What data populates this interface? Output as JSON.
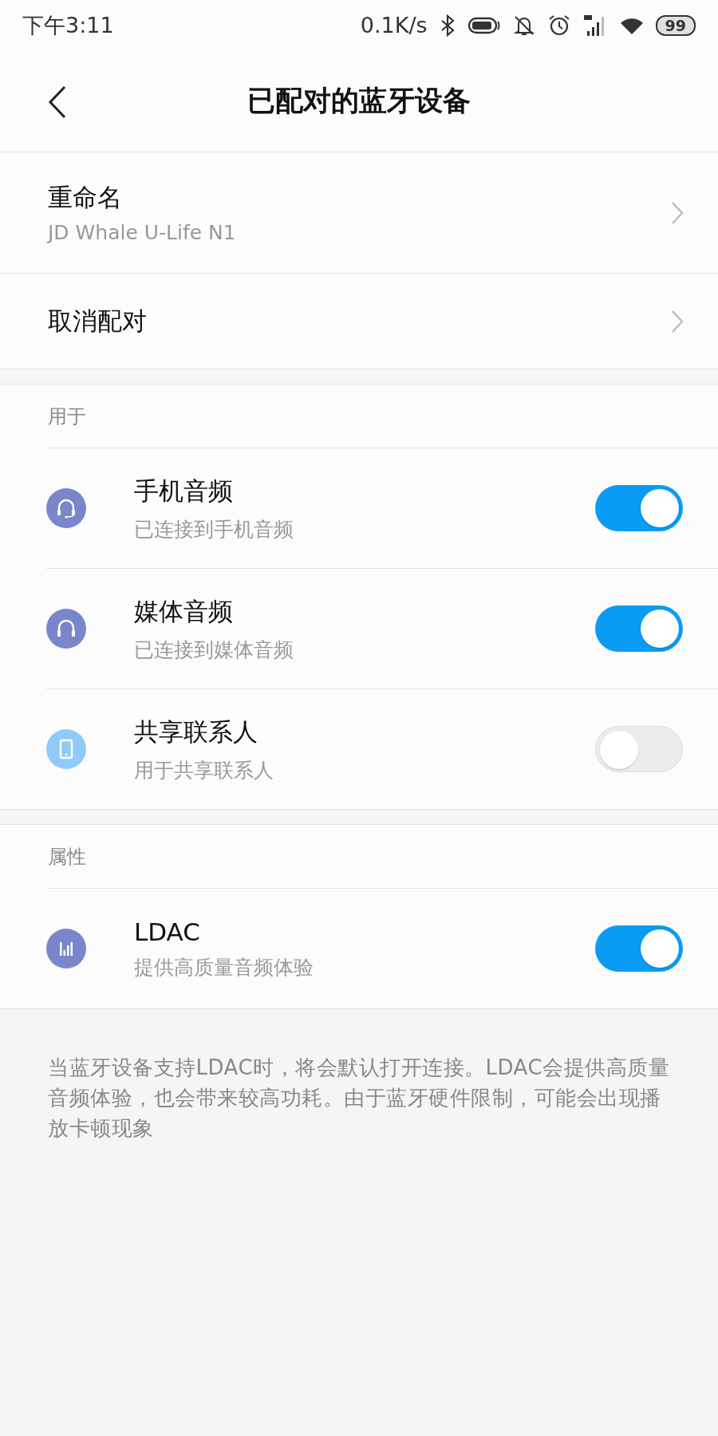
{
  "status_bar": {
    "time": "下午3:11",
    "speed": "0.1K/s",
    "battery": "99"
  },
  "header": {
    "title": "已配对的蓝牙设备"
  },
  "device_actions": [
    {
      "title": "重命名",
      "subtitle": "JD Whale U-Life N1"
    },
    {
      "title": "取消配对"
    }
  ],
  "sections": [
    {
      "header": "用于",
      "items": [
        {
          "kind": "headset",
          "color": "#7986cb",
          "title": "手机音频",
          "subtitle": "已连接到手机音频",
          "on": true
        },
        {
          "kind": "headphones",
          "color": "#7986cb",
          "title": "媒体音频",
          "subtitle": "已连接到媒体音频",
          "on": true
        },
        {
          "kind": "phone",
          "color": "#90caf9",
          "title": "共享联系人",
          "subtitle": "用于共享联系人",
          "on": false
        }
      ]
    },
    {
      "header": "属性",
      "items": [
        {
          "kind": "bars",
          "color": "#7986cb",
          "title": "LDAC",
          "subtitle": "提供高质量音频体验",
          "on": true
        }
      ]
    }
  ],
  "footer_note": "当蓝牙设备支持LDAC时，将会默认打开连接。LDAC会提供高质量音频体验，也会带来较高功耗。由于蓝牙硬件限制，可能会出现播放卡顿现象"
}
